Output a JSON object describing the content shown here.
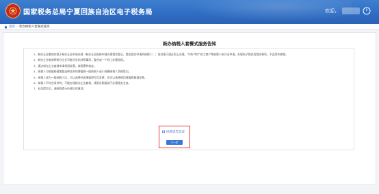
{
  "header": {
    "site_title": "国家税务总局宁夏回族自治区电子税务局",
    "user_name": "欢迎，"
  },
  "breadcrumb": {
    "home": "首页",
    "current": "新办纳税人套餐式服务"
  },
  "notice": {
    "title": "新办纳税人套餐式服务告知",
    "paragraphs": [
      "1、新办企业套餐仅限于新办企业申请办理（新办企业指新申请办理税务登记，提出相关申请的纳税人）；但仅限于通过网上办理。个体户和个体工商户等纳税人新开业申请，办理电子税务局相关事项，不适用本套餐。",
      "2、新办企业套餐将新办企业可能涉及的涉税事项，整合成一个线上办理流程。",
      "3、通过新办企业套餐申请领用发票，按照票种核定。",
      "4、纳税人可根据经营需要选择适合的增值税一般纳税人或小规模纳税人资格登记。",
      "5、纳税人成为一般纳税人后，可以选择开具增值税专用发票，也可以选择使用增值税普通发票。",
      "6、纳税人不符合条件的，不能办理新办企业套餐，请到办税服务厅办理相关业务。",
      "7、业务提交后，请按照提示办理后续事项。"
    ]
  },
  "confirm": {
    "checkbox_label": "已阅读无异议",
    "checked": false
  },
  "actions": {
    "next_label": "下一步"
  },
  "colors": {
    "header_blue": "#2f6ec4",
    "button_blue": "#3a78d6",
    "highlight_red": "#e53935"
  }
}
